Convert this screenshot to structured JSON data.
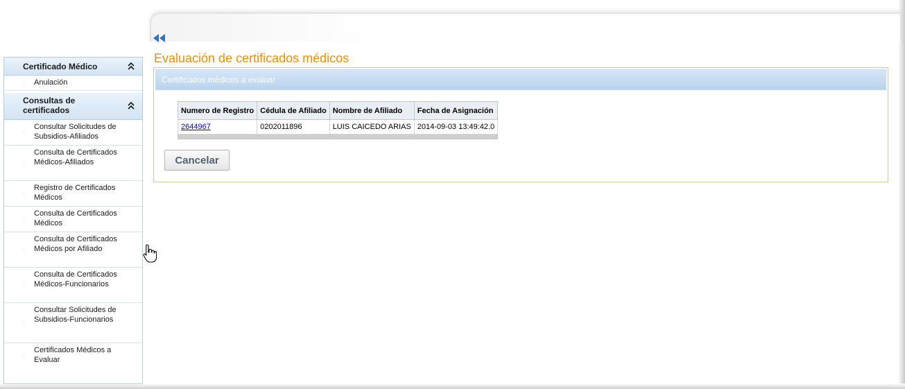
{
  "sidebar": {
    "sections": [
      {
        "title": "Certificado Médico",
        "items": [
          "Anulación"
        ]
      },
      {
        "title": "Consultas de certificados",
        "items": [
          "Consultar Solicitudes de Subsidios-Afiliados",
          "Consulta de Certificados Médicos-Afiliados",
          "Registro de Certificados Médicos",
          "Consulta de Certificados Médicos",
          "Consulta de Certificados Médicos por Afiliado",
          "Consulta de Certificados Médicos-Funcionarios",
          "Consultar Solicitudes de Subsidios-Funcionarios",
          "Certificados Médicos a Evaluar"
        ]
      }
    ]
  },
  "main": {
    "title": "Evaluación de certificados médicos",
    "panel_title": "Certificados médicos a evaluar",
    "table": {
      "headers": [
        "Numero de Registro",
        "Cédula de Afiliado",
        "Nombre de Afiliado",
        "Fecha de Asignación"
      ],
      "rows": [
        [
          "2644967",
          "0202011896",
          "LUIS CAICEDO ARIAS",
          "2014-09-03 13:49:42.0"
        ]
      ]
    },
    "cancel_label": "Cancelar"
  },
  "colors": {
    "title": "#f18f00",
    "sidebar_header": "#d3e4f4",
    "panel_header": "#b9d4ef",
    "link": "#0000ee"
  },
  "icons": {
    "collapse": "double-left-arrow-icon",
    "section_toggle": "double-chevron-up-icon",
    "bullet": "bullet-icon",
    "cursor": "hand-pointer-icon"
  }
}
